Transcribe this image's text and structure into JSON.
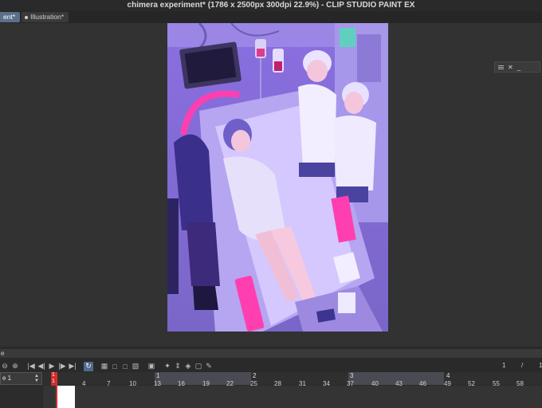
{
  "window": {
    "title": "chimera experiment* (1786 x 2500px 300dpi 22.9%) - CLIP STUDIO PAINT EX"
  },
  "tabs": [
    {
      "label": "ent*",
      "active": true
    },
    {
      "label": "Illustration*",
      "active": false
    }
  ],
  "palette": {
    "close_label": "✕",
    "minimize_label": "_"
  },
  "timeline": {
    "panel_label": "e",
    "track_name": "e 1",
    "current_frame_top": "1",
    "current_frame_bottom": "1",
    "right_readout_a": "1",
    "right_readout_sep": "/",
    "right_readout_b": "1",
    "second_markers": [
      "1",
      "2",
      "3",
      "4"
    ],
    "frame_ticks": [
      "4",
      "7",
      "10",
      "13",
      "16",
      "19",
      "22",
      "25",
      "28",
      "31",
      "34",
      "37",
      "40",
      "43",
      "46",
      "49",
      "52",
      "55",
      "58"
    ]
  },
  "colors": {
    "accent_tab": "#5a6f8a",
    "playhead": "#d42a2a",
    "selected_tool": "#4d6b8c"
  }
}
